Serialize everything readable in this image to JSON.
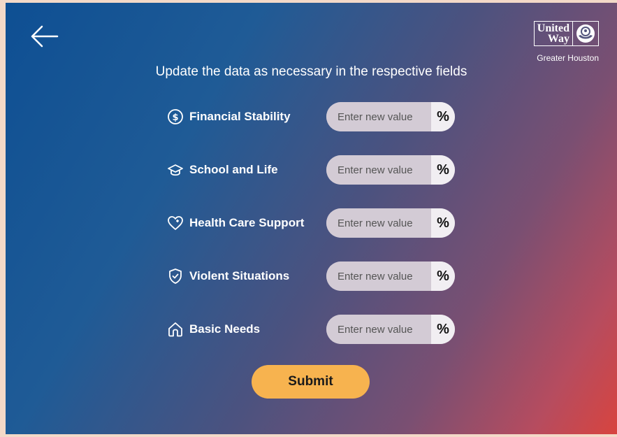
{
  "header": {
    "back_icon": "arrow-left-icon",
    "logo": {
      "line1": "United",
      "line2": "Way",
      "subtitle": "Greater Houston",
      "mark_icon": "united-way-hand-icon"
    },
    "title": "Update the data as necessary in the respective fields"
  },
  "fields": [
    {
      "label": "Financial Stability",
      "icon": "dollar-circle-icon",
      "placeholder": "Enter new value",
      "unit": "%"
    },
    {
      "label": "School and Life",
      "icon": "graduation-cap-icon",
      "placeholder": "Enter new value",
      "unit": "%"
    },
    {
      "label": "Health Care Support",
      "icon": "heart-plus-icon",
      "placeholder": "Enter new value",
      "unit": "%"
    },
    {
      "label": "Violent Situations",
      "icon": "shield-check-icon",
      "placeholder": "Enter new value",
      "unit": "%"
    },
    {
      "label": "Basic Needs",
      "icon": "home-icon",
      "placeholder": "Enter new value",
      "unit": "%"
    }
  ],
  "submit": {
    "label": "Submit"
  },
  "colors": {
    "accent": "#f7b34f",
    "field_bg": "#d3cbd5",
    "unit_bg": "#f1eef2"
  }
}
